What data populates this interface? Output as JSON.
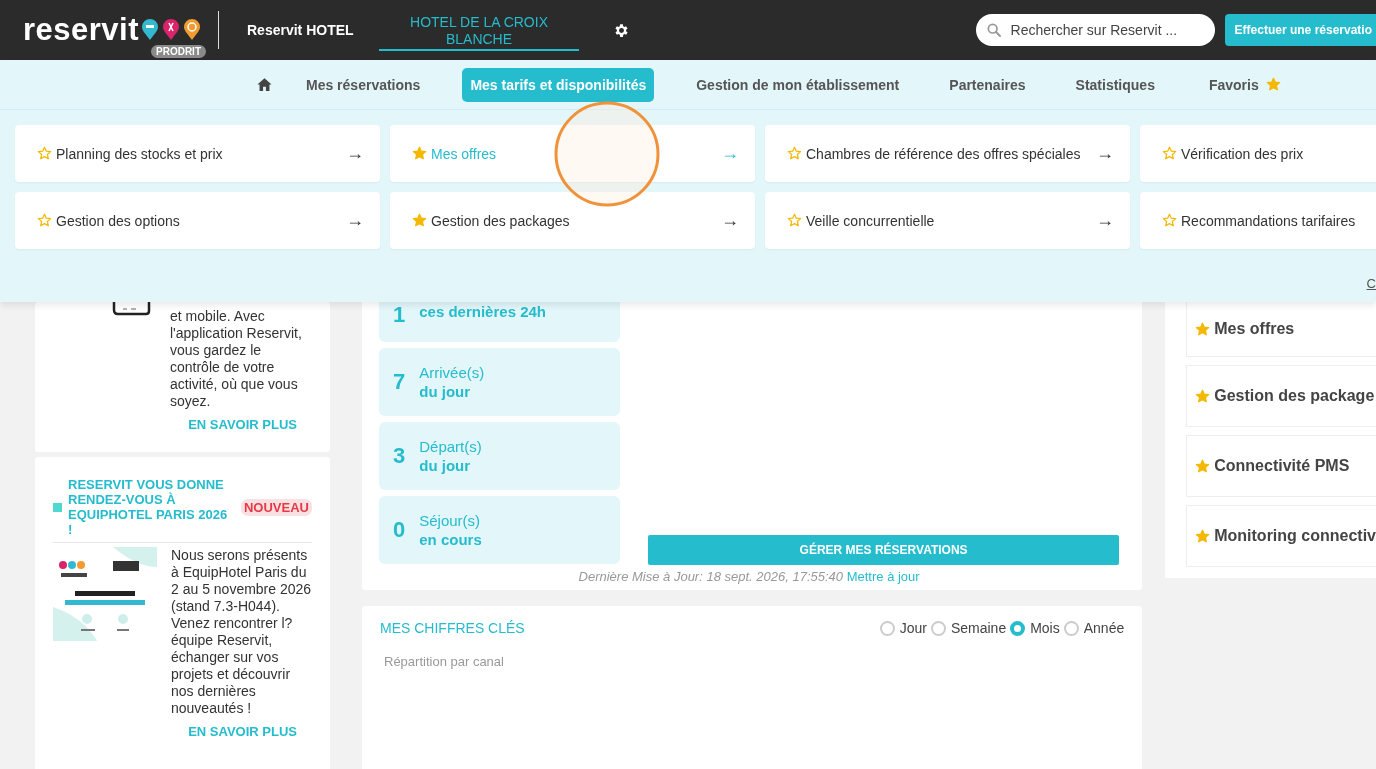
{
  "header": {
    "logo": "reservit",
    "logo_badge": "PRODRIT",
    "hotel_group": "Reservit HOTEL",
    "hotel_name": "HOTEL DE LA CROIX BLANCHE",
    "search": {
      "placeholder": "Rechercher sur Reservit ..."
    },
    "book_button": "Effectuer une réservatio"
  },
  "nav": {
    "items": [
      {
        "label": "Mes réservations",
        "selected": false
      },
      {
        "label": "Mes tarifs et disponibilités",
        "selected": true
      },
      {
        "label": "Gestion de mon établissement",
        "selected": false
      },
      {
        "label": "Partenaires",
        "selected": false
      },
      {
        "label": "Statistiques",
        "selected": false
      }
    ],
    "favorites": "Favoris"
  },
  "mega_menu": {
    "items": [
      {
        "label": "Planning des stocks et prix",
        "favorite": false,
        "selected": false,
        "arrow": "→"
      },
      {
        "label": "Mes offres",
        "favorite": true,
        "selected": true,
        "arrow": "→"
      },
      {
        "label": "Chambres de référence des offres spéciales",
        "favorite": false,
        "selected": false,
        "arrow": "→"
      },
      {
        "label": "Vérification des prix",
        "favorite": false,
        "selected": false
      },
      {
        "label": "Gestion des options",
        "favorite": false,
        "selected": false,
        "arrow": "→"
      },
      {
        "label": "Gestion des packages",
        "favorite": true,
        "selected": false,
        "arrow": "→"
      },
      {
        "label": "Veille concurrentielle",
        "favorite": false,
        "selected": false,
        "arrow": "→"
      },
      {
        "label": "Recommandations tarifaires",
        "favorite": false,
        "selected": false
      }
    ],
    "corner_link": "C"
  },
  "news": [
    {
      "text": "et mobile. Avec l'application Reservit, vous gardez le contrôle de votre activité, où que vous soyez.",
      "link": "EN SAVOIR PLUS"
    },
    {
      "title": "RESERVIT VOUS DONNE RENDEZ-VOUS À EQUIPHOTEL PARIS 2026 !",
      "badge": "NOUVEAU",
      "text": "Nous serons présents à EquipHotel Paris du 2 au 5 novembre 2026 (stand 7.3-H044). Venez rencontrer l?équipe Reservit, échanger sur vos projets et découvrir nos dernières nouveautés !",
      "link": "EN SAVOIR PLUS"
    }
  ],
  "stats": [
    {
      "value": "1",
      "line2": "ces dernières 24h"
    },
    {
      "value": "7",
      "line1": "Arrivée(s)",
      "line2": "du jour"
    },
    {
      "value": "3",
      "line1": "Départ(s)",
      "line2": "du jour"
    },
    {
      "value": "0",
      "line1": "Séjour(s)",
      "line2": "en cours"
    }
  ],
  "manage_button": "GÉRER MES RÉSERVATIONS",
  "last_update": "Dernière Mise à Jour: 18 sept. 2026, 17:55:40",
  "refresh_link": "Mettre à jour",
  "key_figures": {
    "title": "MES CHIFFRES CLÉS",
    "periods": [
      {
        "label": "Jour",
        "selected": false
      },
      {
        "label": "Semaine",
        "selected": false
      },
      {
        "label": "Mois",
        "selected": true
      },
      {
        "label": "Année",
        "selected": false
      }
    ],
    "subtitle": "Répartition par canal"
  },
  "favorites_list": [
    {
      "label": "Mes offres"
    },
    {
      "label": "Gestion des package"
    },
    {
      "label": "Connectivité PMS"
    },
    {
      "label": "Monitoring connectiv"
    }
  ]
}
